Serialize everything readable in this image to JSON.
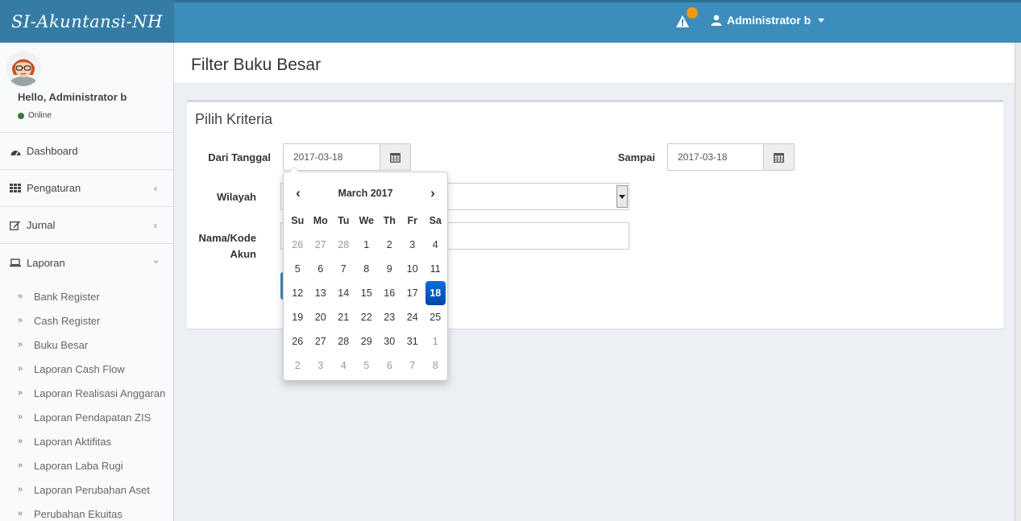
{
  "app": {
    "title": "SI-Akuntansi-NH"
  },
  "header": {
    "user_name": "Administrator b"
  },
  "sidebar": {
    "hello": "Hello, Administrator b",
    "status": "Online",
    "menu": [
      {
        "label": "Dashboard"
      },
      {
        "label": "Pengaturan"
      },
      {
        "label": "Jurnal"
      },
      {
        "label": "Laporan"
      }
    ],
    "laporan_items": [
      "Bank Register",
      "Cash Register",
      "Buku Besar",
      "Laporan Cash Flow",
      "Laporan Realisasi Anggaran",
      "Laporan Pendapatan ZIS",
      "Laporan Aktifitas",
      "Laporan Laba Rugi",
      "Laporan Perubahan Aset",
      "Perubahan Ekuitas"
    ]
  },
  "page": {
    "title": "Filter Buku Besar"
  },
  "form": {
    "box_title": "Pilih Kriteria",
    "dari_label": "Dari Tanggal",
    "dari_value": "2017-03-18",
    "sampai_label": "Sampai",
    "sampai_value": "2017-03-18",
    "wilayah_label": "Wilayah",
    "nama_label_1": "Nama/Kode",
    "nama_label_2": "Akun"
  },
  "datepicker": {
    "month_label": "March 2017",
    "prev": "‹",
    "next": "›",
    "dow": [
      "Su",
      "Mo",
      "Tu",
      "We",
      "Th",
      "Fr",
      "Sa"
    ],
    "selected": 18,
    "weeks": [
      [
        {
          "d": "26",
          "o": true
        },
        {
          "d": "27",
          "o": true
        },
        {
          "d": "28",
          "o": true
        },
        {
          "d": "1"
        },
        {
          "d": "2"
        },
        {
          "d": "3"
        },
        {
          "d": "4"
        }
      ],
      [
        {
          "d": "5"
        },
        {
          "d": "6"
        },
        {
          "d": "7"
        },
        {
          "d": "8"
        },
        {
          "d": "9"
        },
        {
          "d": "10"
        },
        {
          "d": "11"
        }
      ],
      [
        {
          "d": "12"
        },
        {
          "d": "13"
        },
        {
          "d": "14"
        },
        {
          "d": "15"
        },
        {
          "d": "16"
        },
        {
          "d": "17"
        },
        {
          "d": "18",
          "a": true
        }
      ],
      [
        {
          "d": "19"
        },
        {
          "d": "20"
        },
        {
          "d": "21"
        },
        {
          "d": "22"
        },
        {
          "d": "23"
        },
        {
          "d": "24"
        },
        {
          "d": "25"
        }
      ],
      [
        {
          "d": "26"
        },
        {
          "d": "27"
        },
        {
          "d": "28"
        },
        {
          "d": "29"
        },
        {
          "d": "30"
        },
        {
          "d": "31"
        },
        {
          "d": "1",
          "o": true
        }
      ],
      [
        {
          "d": "2",
          "o": true
        },
        {
          "d": "3",
          "o": true
        },
        {
          "d": "4",
          "o": true
        },
        {
          "d": "5",
          "o": true
        },
        {
          "d": "6",
          "o": true
        },
        {
          "d": "7",
          "o": true
        },
        {
          "d": "8",
          "o": true
        }
      ]
    ]
  },
  "colors": {
    "header": "#3c8dbc",
    "logo_bg": "#357ca5",
    "alert_dot": "#f39c12",
    "active_day": "#0a6fd9"
  },
  "icons": {
    "alert": "warning-icon",
    "user": "user-icon",
    "calendar": "calendar-icon",
    "dashboard": "dashboard-icon",
    "pengaturan": "grid-icon",
    "jurnal": "edit-icon",
    "laporan": "laptop-icon"
  }
}
